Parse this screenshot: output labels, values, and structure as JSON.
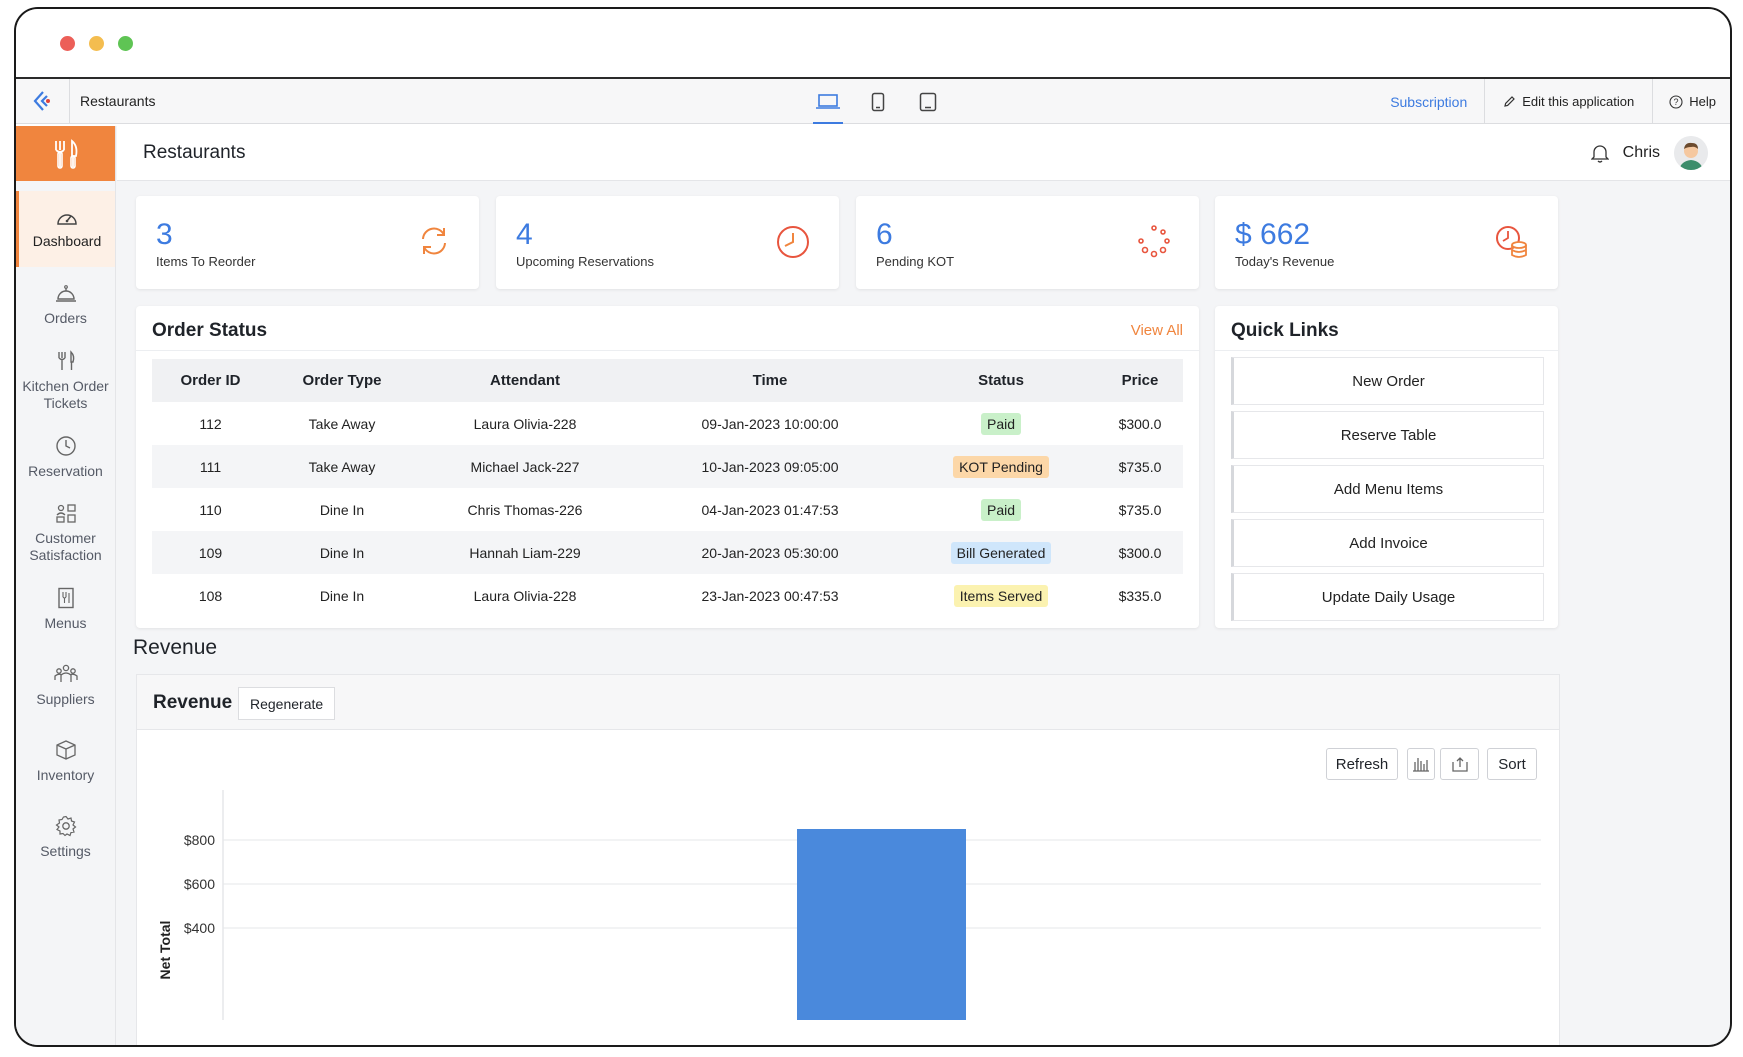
{
  "app": {
    "name": "Restaurants",
    "subscription": "Subscription",
    "edit": "Edit this application",
    "help": "Help"
  },
  "devices": [
    {
      "name": "desktop-icon",
      "active": true
    },
    {
      "name": "tablet-icon",
      "active": false
    },
    {
      "name": "mobile-icon",
      "active": false
    }
  ],
  "topbar": {
    "title": "Restaurants",
    "user": "Chris"
  },
  "sidebar": {
    "items": [
      {
        "label": "Dashboard",
        "icon": "dashboard-icon"
      },
      {
        "label": "Orders",
        "icon": "bell-cloche-icon"
      },
      {
        "label": "Kitchen Order Tickets",
        "icon": "utensils-icon"
      },
      {
        "label": "Reservation",
        "icon": "clock-icon"
      },
      {
        "label": "Customer Satisfaction",
        "icon": "people-chart-icon"
      },
      {
        "label": "Menus",
        "icon": "menu-book-icon"
      },
      {
        "label": "Suppliers",
        "icon": "group-icon"
      },
      {
        "label": "Inventory",
        "icon": "box-icon"
      },
      {
        "label": "Settings",
        "icon": "gear-icon"
      }
    ]
  },
  "stats": [
    {
      "value": "3",
      "label": "Items To Reorder",
      "icon": "refresh-icon"
    },
    {
      "value": "4",
      "label": "Upcoming Reservations",
      "icon": "clock-icon"
    },
    {
      "value": "6",
      "label": "Pending KOT",
      "icon": "loading-icon"
    },
    {
      "value": "$ 662",
      "label": "Today's Revenue",
      "icon": "coins-clock-icon"
    }
  ],
  "order_status": {
    "title": "Order Status",
    "view_all": "View All",
    "columns": [
      "Order ID",
      "Order Type",
      "Attendant",
      "Time",
      "Status",
      "Price"
    ],
    "rows": [
      {
        "id": "112",
        "type": "Take Away",
        "attendant": "Laura Olivia-228",
        "time": "09-Jan-2023 10:00:00",
        "status": "Paid",
        "status_color": "#c9f0c9",
        "price": "$300.0"
      },
      {
        "id": "111",
        "type": "Take Away",
        "attendant": "Michael Jack-227",
        "time": "10-Jan-2023 09:05:00",
        "status": "KOT Pending",
        "status_color": "#fcd7a8",
        "price": "$735.0"
      },
      {
        "id": "110",
        "type": "Dine In",
        "attendant": "Chris Thomas-226",
        "time": "04-Jan-2023 01:47:53",
        "status": "Paid",
        "status_color": "#c9f0c9",
        "price": "$735.0"
      },
      {
        "id": "109",
        "type": "Dine In",
        "attendant": "Hannah Liam-229",
        "time": "20-Jan-2023 05:30:00",
        "status": "Bill Generated",
        "status_color": "#cfe6fb",
        "price": "$300.0"
      },
      {
        "id": "108",
        "type": "Dine In",
        "attendant": "Laura Olivia-228",
        "time": "23-Jan-2023 00:47:53",
        "status": "Items Served",
        "status_color": "#fbf2b0",
        "price": "$335.0"
      }
    ]
  },
  "quick_links": {
    "title": "Quick Links",
    "items": [
      "New Order",
      "Reserve Table",
      "Add Menu Items",
      "Add Invoice",
      "Update Daily Usage"
    ]
  },
  "revenue": {
    "section_title": "Revenue",
    "card_title": "Revenue",
    "regenerate": "Regenerate",
    "refresh": "Refresh",
    "sort": "Sort"
  },
  "chart_data": {
    "type": "bar",
    "ylabel": "Net Total",
    "y_ticks": [
      "$800",
      "$600",
      "$400"
    ],
    "y_tick_values": [
      800,
      600,
      400
    ],
    "values": [
      850
    ],
    "grid": true,
    "color": "#4a89dc"
  },
  "colors": {
    "accent": "#f0853e",
    "primary": "#3d7be0"
  }
}
